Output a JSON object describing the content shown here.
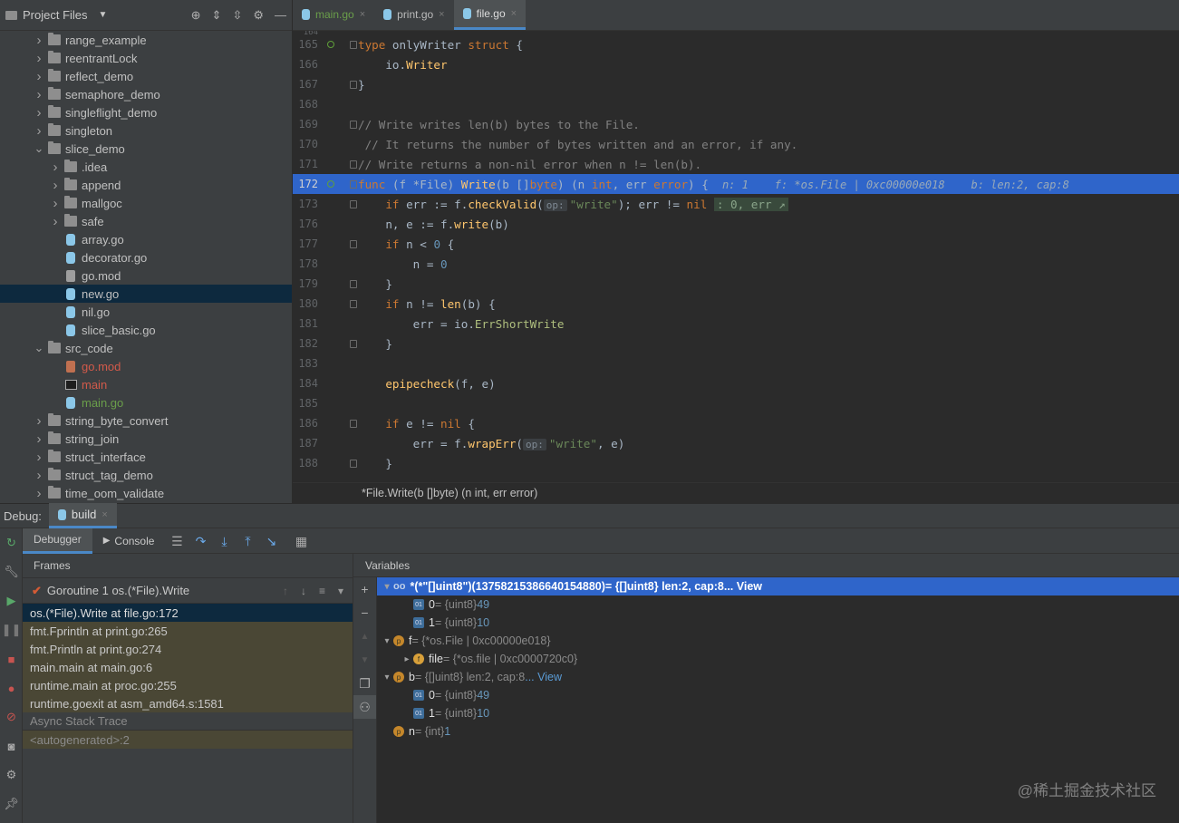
{
  "project": {
    "title": "Project Files",
    "items": [
      {
        "label": "range_example",
        "kind": "folder",
        "depth": 0,
        "open": false
      },
      {
        "label": "reentrantLock",
        "kind": "folder",
        "depth": 0,
        "open": false
      },
      {
        "label": "reflect_demo",
        "kind": "folder",
        "depth": 0,
        "open": false
      },
      {
        "label": "semaphore_demo",
        "kind": "folder",
        "depth": 0,
        "open": false
      },
      {
        "label": "singleflight_demo",
        "kind": "folder",
        "depth": 0,
        "open": false
      },
      {
        "label": "singleton",
        "kind": "folder",
        "depth": 0,
        "open": false
      },
      {
        "label": "slice_demo",
        "kind": "folder",
        "depth": 0,
        "open": true
      },
      {
        "label": ".idea",
        "kind": "folder",
        "depth": 1,
        "open": false
      },
      {
        "label": "append",
        "kind": "folder",
        "depth": 1,
        "open": false
      },
      {
        "label": "mallgoc",
        "kind": "folder",
        "depth": 1,
        "open": false
      },
      {
        "label": "safe",
        "kind": "folder",
        "depth": 1,
        "open": false
      },
      {
        "label": "array.go",
        "kind": "go",
        "depth": 1
      },
      {
        "label": "decorator.go",
        "kind": "go",
        "depth": 1
      },
      {
        "label": "go.mod",
        "kind": "mod",
        "depth": 1
      },
      {
        "label": "new.go",
        "kind": "go",
        "depth": 1,
        "selected": true
      },
      {
        "label": "nil.go",
        "kind": "go",
        "depth": 1
      },
      {
        "label": "slice_basic.go",
        "kind": "go",
        "depth": 1
      },
      {
        "label": "src_code",
        "kind": "folder",
        "depth": 0,
        "open": true
      },
      {
        "label": "go.mod",
        "kind": "modred",
        "depth": 1,
        "color": "#d25a4a"
      },
      {
        "label": "main",
        "kind": "exe",
        "depth": 1,
        "color": "#d25a4a"
      },
      {
        "label": "main.go",
        "kind": "gogreen",
        "depth": 1,
        "color": "#6a9e4a"
      },
      {
        "label": "string_byte_convert",
        "kind": "folder",
        "depth": 0,
        "open": false
      },
      {
        "label": "string_join",
        "kind": "folder",
        "depth": 0,
        "open": false
      },
      {
        "label": "struct_interface",
        "kind": "folder",
        "depth": 0,
        "open": false
      },
      {
        "label": "struct_tag_demo",
        "kind": "folder",
        "depth": 0,
        "open": false
      },
      {
        "label": "time_oom_validate",
        "kind": "folder",
        "depth": 0,
        "open": false
      }
    ]
  },
  "tabs": [
    {
      "label": "main.go",
      "color": "#6a9e4a",
      "active": false
    },
    {
      "label": "print.go",
      "color": "#bbbbbb",
      "active": false
    },
    {
      "label": "file.go",
      "color": "#dcdcdc",
      "active": true
    }
  ],
  "editor": {
    "first_line": "164",
    "lines": [
      {
        "n": "165",
        "bp": true,
        "fold": true,
        "segs": [
          [
            "kw",
            "type "
          ],
          [
            "",
            "onlyWriter "
          ],
          [
            "kw",
            "struct "
          ],
          [
            "",
            "{"
          ]
        ]
      },
      {
        "n": "166",
        "segs": [
          [
            "",
            "    "
          ],
          [
            "",
            "io."
          ],
          [
            "fn",
            "Writer"
          ]
        ]
      },
      {
        "n": "167",
        "fold": true,
        "segs": [
          [
            "",
            "}"
          ]
        ]
      },
      {
        "n": "168",
        "segs": []
      },
      {
        "n": "169",
        "fold": true,
        "segs": [
          [
            "cm",
            "// Write writes len(b) bytes to the File."
          ]
        ]
      },
      {
        "n": "170",
        "segs": [
          [
            "cm",
            " // It returns the number of bytes written and an error, if any."
          ]
        ]
      },
      {
        "n": "171",
        "fold": true,
        "segs": [
          [
            "cm",
            "// Write returns a non-nil error when n != len(b)."
          ]
        ]
      },
      {
        "n": "172",
        "bp": true,
        "fold": true,
        "hl": true,
        "segs": [
          [
            "kw",
            "func "
          ],
          [
            "",
            "(f *File) "
          ],
          [
            "fn",
            "Write"
          ],
          [
            "",
            "(b []"
          ],
          [
            "kw",
            "byte"
          ],
          [
            "",
            ") (n "
          ],
          [
            "kw",
            "int"
          ],
          [
            "",
            ", err "
          ],
          [
            "kw",
            "error"
          ],
          [
            "",
            ") {  "
          ],
          [
            "inl",
            "n: 1    f: *os.File | 0xc00000e018    b: len:2, cap:8"
          ]
        ]
      },
      {
        "n": "173",
        "fold": true,
        "segs": [
          [
            "",
            "    "
          ],
          [
            "kw",
            "if "
          ],
          [
            "",
            "err := f."
          ],
          [
            "fn",
            "checkValid"
          ],
          [
            "",
            "("
          ],
          [
            "hint",
            "op:"
          ],
          [
            "st",
            "\"write\""
          ],
          [
            "",
            "); err != "
          ],
          [
            "kw",
            "nil "
          ],
          [
            "inlbox",
            ": 0, err ↗"
          ]
        ]
      },
      {
        "n": "176",
        "segs": [
          [
            "",
            "    n, e := f."
          ],
          [
            "fn",
            "write"
          ],
          [
            "",
            "(b)"
          ]
        ]
      },
      {
        "n": "177",
        "fold": true,
        "segs": [
          [
            "",
            "    "
          ],
          [
            "kw",
            "if "
          ],
          [
            "",
            "n < "
          ],
          [
            "nm",
            "0"
          ],
          [
            "",
            " {"
          ]
        ]
      },
      {
        "n": "178",
        "segs": [
          [
            "",
            "        n = "
          ],
          [
            "nm",
            "0"
          ]
        ]
      },
      {
        "n": "179",
        "fold": true,
        "segs": [
          [
            "",
            "    }"
          ]
        ]
      },
      {
        "n": "180",
        "fold": true,
        "segs": [
          [
            "",
            "    "
          ],
          [
            "kw",
            "if "
          ],
          [
            "",
            "n != "
          ],
          [
            "fn",
            "len"
          ],
          [
            "",
            "(b) {"
          ]
        ]
      },
      {
        "n": "181",
        "segs": [
          [
            "",
            "        err = io."
          ],
          [
            "pk",
            "ErrShortWrite"
          ]
        ]
      },
      {
        "n": "182",
        "fold": true,
        "segs": [
          [
            "",
            "    }"
          ]
        ]
      },
      {
        "n": "183",
        "segs": []
      },
      {
        "n": "184",
        "segs": [
          [
            "",
            "    "
          ],
          [
            "fn",
            "epipecheck"
          ],
          [
            "",
            "(f, e)"
          ]
        ]
      },
      {
        "n": "185",
        "segs": []
      },
      {
        "n": "186",
        "fold": true,
        "segs": [
          [
            "",
            "    "
          ],
          [
            "kw",
            "if "
          ],
          [
            "",
            "e != "
          ],
          [
            "kw",
            "nil "
          ],
          [
            "",
            "{"
          ]
        ]
      },
      {
        "n": "187",
        "segs": [
          [
            "",
            "        err = f."
          ],
          [
            "fn",
            "wrapErr"
          ],
          [
            "",
            "("
          ],
          [
            "hint",
            "op:"
          ],
          [
            "st",
            "\"write\""
          ],
          [
            "",
            ", e)"
          ]
        ]
      },
      {
        "n": "188",
        "fold": true,
        "segs": [
          [
            "",
            "    }"
          ]
        ]
      }
    ]
  },
  "breadcrumb": "*File.Write(b []byte) (n int, err error)",
  "debug": {
    "label": "Debug:",
    "config": "build",
    "tabs": {
      "debugger": "Debugger",
      "console": "Console"
    },
    "frames_title": "Frames",
    "goroutine": "Goroutine 1 os.(*File).Write",
    "frames": [
      {
        "label": "os.(*File).Write at file.go:172",
        "selected": true
      },
      {
        "label": "fmt.Fprintln at print.go:265"
      },
      {
        "label": "fmt.Println at print.go:274"
      },
      {
        "label": "main.main at main.go:6"
      },
      {
        "label": "runtime.main at proc.go:255"
      },
      {
        "label": "runtime.goexit at asm_amd64.s:1581"
      }
    ],
    "async_label": "Async Stack Trace",
    "autogen": "<autogenerated>:2",
    "variables_title": "Variables",
    "variables": [
      {
        "depth": 0,
        "arrow": "▾",
        "icon": "oo",
        "name": "*(*\"[]uint8\")(13758215386640154880)",
        "type": " = {[]uint8} len:2, cap:8",
        "link": " ... View",
        "selected": true
      },
      {
        "depth": 1,
        "arrow": "",
        "icon": "01",
        "name": "0",
        "type": " = {uint8} ",
        "val": "49"
      },
      {
        "depth": 1,
        "arrow": "",
        "icon": "01",
        "name": "1",
        "type": " = {uint8} ",
        "val": "10"
      },
      {
        "depth": 0,
        "arrow": "▾",
        "icon": "p",
        "name": "f",
        "type": " = {*os.File | 0xc00000e018}"
      },
      {
        "depth": 1,
        "arrow": "▸",
        "icon": "f",
        "name": "file",
        "type": " = {*os.file | 0xc0000720c0}"
      },
      {
        "depth": 0,
        "arrow": "▾",
        "icon": "p",
        "name": "b",
        "type": " = {[]uint8} len:2, cap:8",
        "link": " ... View"
      },
      {
        "depth": 1,
        "arrow": "",
        "icon": "01",
        "name": "0",
        "type": " = {uint8} ",
        "val": "49"
      },
      {
        "depth": 1,
        "arrow": "",
        "icon": "01",
        "name": "1",
        "type": " = {uint8} ",
        "val": "10"
      },
      {
        "depth": 0,
        "arrow": "",
        "icon": "p",
        "name": "n",
        "type": " = {int} ",
        "val": "1"
      }
    ]
  },
  "watermark": "@稀土掘金技术社区"
}
